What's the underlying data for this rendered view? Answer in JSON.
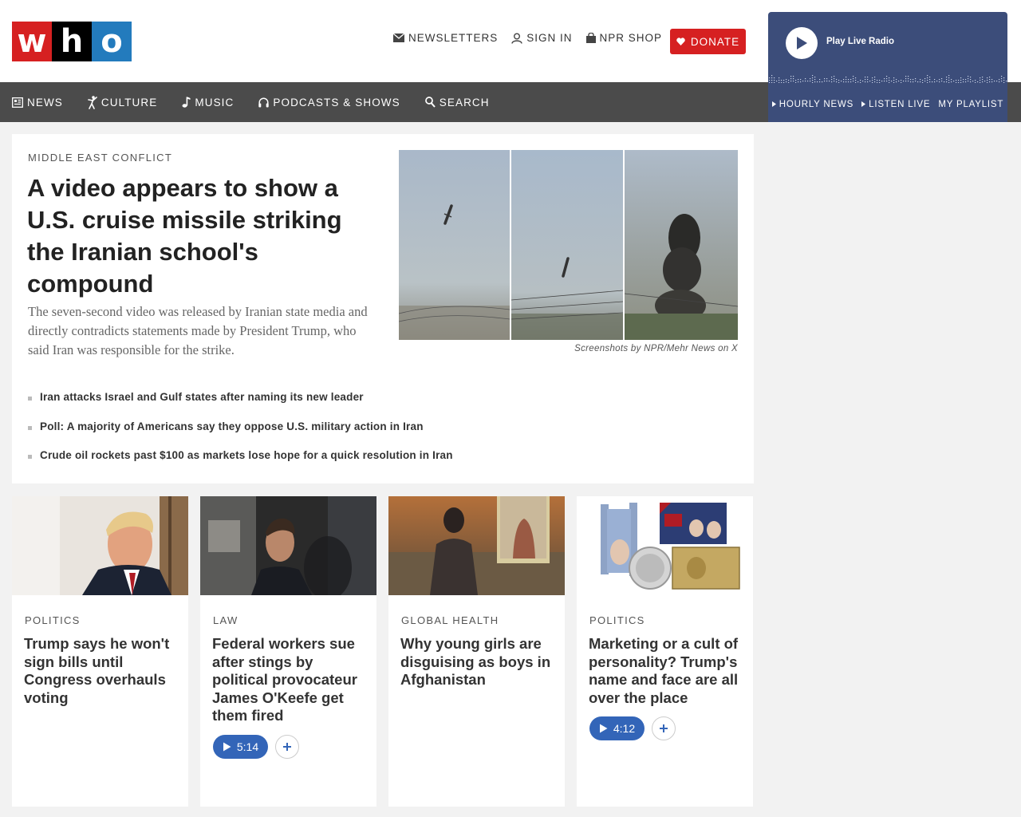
{
  "logo": {
    "letters": [
      "w",
      "h",
      "o"
    ]
  },
  "utility": {
    "newsletters": "NEWSLETTERS",
    "sign_in": "SIGN IN",
    "shop": "NPR SHOP",
    "donate": "DONATE"
  },
  "nav": {
    "news": "NEWS",
    "culture": "CULTURE",
    "music": "MUSIC",
    "podcasts": "PODCASTS & SHOWS",
    "search": "SEARCH"
  },
  "player": {
    "label": "Play Live Radio",
    "links": [
      "HOURLY NEWS",
      "LISTEN LIVE",
      "MY PLAYLIST"
    ]
  },
  "featured": {
    "slug": "MIDDLE EAST CONFLICT",
    "title": "A video appears to show a U.S. cruise missile striking the Iranian school's compound",
    "teaser": "The seven-second video was released by Iranian state media and directly contradicts statements made by President Trump, who said Iran was responsible for the strike.",
    "credit": "Screenshots by NPR/Mehr News on X",
    "related": [
      "Iran attacks Israel and Gulf states after naming its new leader",
      "Poll: A majority of Americans say they oppose U.S. military action in Iran",
      "Crude oil rockets past $100 as markets lose hope for a quick resolution in Iran"
    ]
  },
  "cards": [
    {
      "slug": "POLITICS",
      "title": "Trump says he won't sign bills until Congress overhauls voting"
    },
    {
      "slug": "LAW",
      "title": "Federal workers sue after stings by political provocateur James O'Keefe get them fired",
      "audio": "5:14"
    },
    {
      "slug": "GLOBAL HEALTH",
      "title": "Why young girls are disguising as boys in Afghanistan"
    },
    {
      "slug": "POLITICS",
      "title": "Marketing or a cult of personality? Trump's name and face are all over the place",
      "audio": "4:12"
    }
  ],
  "colors": {
    "brand_red": "#d62021",
    "brand_blue": "#237bbd",
    "nav_bg": "#4b4b4b",
    "player_bg": "#3c4d7a",
    "audio_blue": "#3365b8"
  },
  "icons": [
    "envelope-icon",
    "user-icon",
    "shopping-bag-icon",
    "heart-icon",
    "newspaper-icon",
    "dancer-icon",
    "music-note-icon",
    "headphones-icon",
    "search-icon",
    "play-icon",
    "plus-icon"
  ]
}
